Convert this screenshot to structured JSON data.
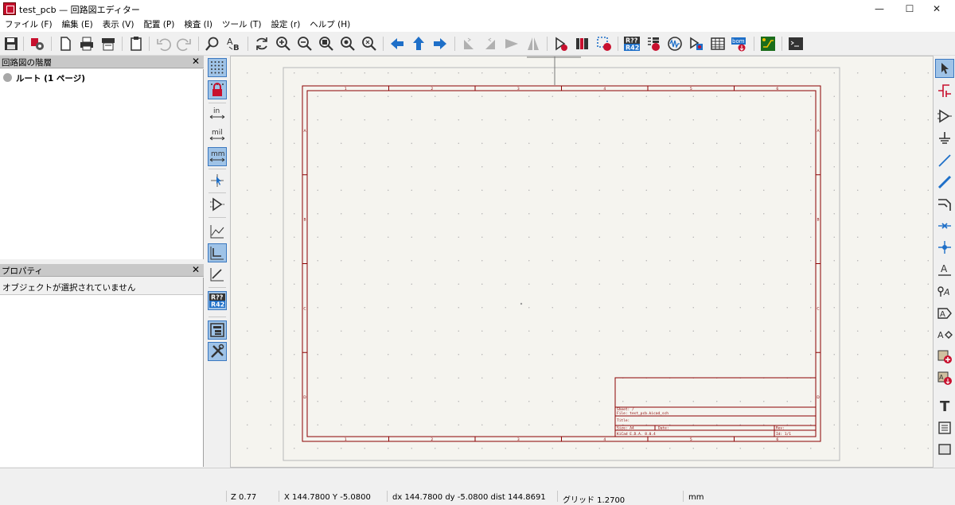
{
  "window": {
    "title": "test_pcb — 回路図エディター"
  },
  "menu": [
    "ファイル (F)",
    "編集 (E)",
    "表示 (V)",
    "配置 (P)",
    "検査 (I)",
    "ツール (T)",
    "設定 (r)",
    "ヘルプ (H)"
  ],
  "hierarchy_panel": {
    "title": "回路図の階層",
    "close": "✕",
    "root_item": "ルート (1 ページ)"
  },
  "properties_panel": {
    "title": "プロパティ",
    "close": "✕",
    "empty_message": "オブジェクトが選択されていません"
  },
  "left_toolbar": {
    "in_label": "in",
    "mil_label": "mil",
    "mm_label": "mm",
    "anno_top": "R??",
    "anno_bottom": "R42"
  },
  "main_toolbar": {
    "anno_top": "R??",
    "anno_bottom": "R42",
    "bom_label": "bom"
  },
  "title_block": {
    "sheet": "Sheet: /",
    "file": "File: test_pcb.kicad_sch",
    "title": "Title:",
    "size": "Size: A4",
    "date": "Date:",
    "rev": "Rev:",
    "kicad": "KiCad E.D.A. 8.0.4",
    "id": "Id: 1/1"
  },
  "border_cols": [
    "1",
    "2",
    "3",
    "4",
    "5",
    "6"
  ],
  "border_rows": [
    "A",
    "B",
    "C",
    "D"
  ],
  "right_toolbar": {
    "label_glyph": "A",
    "text_glyph": "T"
  },
  "status": {
    "zoom": "Z 0.77",
    "xy": "X 144.7800  Y -5.0800",
    "delta": "dx 144.7800  dy -5.0800  dist 144.8691",
    "grid": "グリッド 1.2700",
    "units": "mm"
  },
  "colors": {
    "sheet_border": "#8b0000",
    "selected_tool": "#9fc3e7",
    "canvas_bg": "#f5f4ef"
  }
}
